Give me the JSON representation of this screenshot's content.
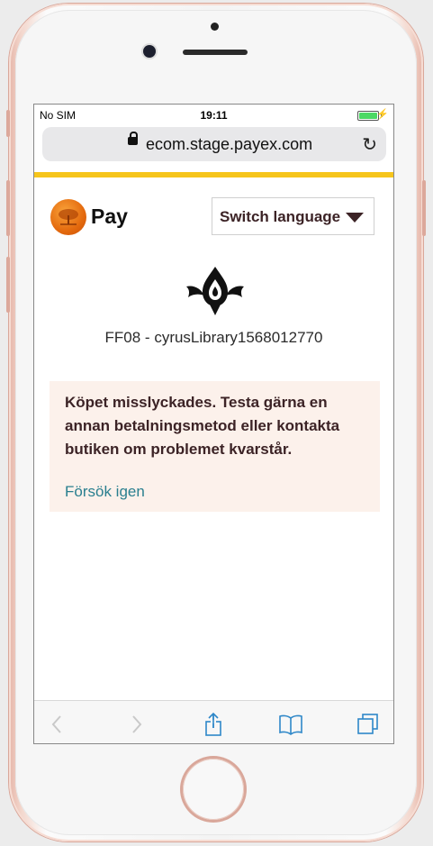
{
  "status_bar": {
    "carrier": "No SIM",
    "time": "19:11",
    "battery_level": 1.0
  },
  "browser": {
    "url": "ecom.stage.payex.com"
  },
  "brand": {
    "name": "Pay",
    "accent_color": "#f6c51b"
  },
  "language": {
    "button_label": "Switch language"
  },
  "merchant": {
    "name": "FF08 - cyrusLibrary1568012770"
  },
  "error": {
    "message": "Köpet misslyckades. Testa gärna en annan betalningsmetod eller kontakta butiken om problemet kvarstår.",
    "retry_label": "Försök igen",
    "background_color": "#fcf1eb",
    "link_color": "#2a7f8f"
  },
  "toolbar": {
    "icons": [
      "back-icon",
      "forward-icon",
      "share-icon",
      "bookmarks-icon",
      "tabs-icon"
    ]
  }
}
